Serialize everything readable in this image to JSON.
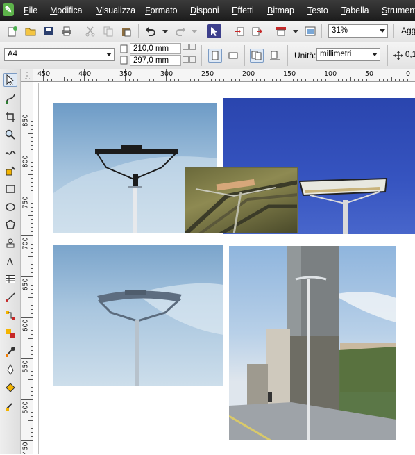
{
  "menu": {
    "items": [
      "File",
      "Modifica",
      "Visualizza",
      "Formato",
      "Disponi",
      "Effetti",
      "Bitmap",
      "Testo",
      "Tabella",
      "Strumenti"
    ]
  },
  "standard_toolbar": {
    "zoom": "31%",
    "truncated_label": "Agg"
  },
  "property_bar": {
    "page_size": "A4",
    "width": "210,0 mm",
    "height": "297,0 mm",
    "units_label": "Unità:",
    "units_value": "millimetri",
    "nudge_value": "0,1"
  },
  "rulers": {
    "horizontal": [
      "450",
      "400",
      "350",
      "300",
      "250",
      "200",
      "150",
      "100",
      "50",
      "0"
    ],
    "vertical": [
      "850",
      "800",
      "750",
      "700",
      "650",
      "600",
      "550",
      "500",
      "450"
    ]
  },
  "colors": {
    "menubar": "#262626",
    "sky_light": "#9ec2de",
    "sky_deep": "#2f4fb8",
    "accent": "#5db34a"
  },
  "icons": [
    "new-document-icon",
    "open-icon",
    "save-icon",
    "print-icon",
    "cut-icon",
    "copy-icon",
    "paste-icon",
    "undo-icon",
    "redo-icon",
    "launcher-icon",
    "import-icon",
    "export-icon",
    "publish-icon",
    "fullscreen-icon",
    "portrait-icon",
    "landscape-icon",
    "all-pages-icon",
    "current-page-icon",
    "nudge-icon"
  ]
}
